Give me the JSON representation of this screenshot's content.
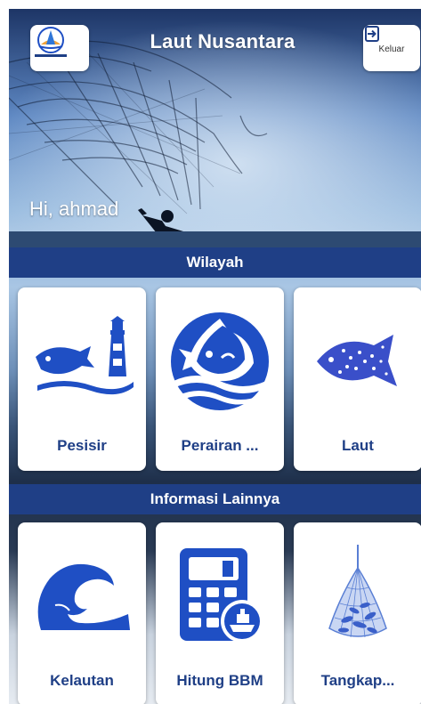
{
  "header": {
    "title": "Laut Nusantara",
    "logout_label": "Keluar",
    "logo_icon": "laut-nusantara-logo"
  },
  "greeting": "Hi, ahmad",
  "sections": {
    "wilayah": {
      "title": "Wilayah",
      "items": [
        {
          "label": "Pesisir",
          "icon": "lighthouse-fish-icon"
        },
        {
          "label": "Perairan ...",
          "icon": "fish-wave-icon"
        },
        {
          "label": "Laut",
          "icon": "fish-school-icon"
        }
      ]
    },
    "informasi": {
      "title": "Informasi Lainnya",
      "items": [
        {
          "label": "Kelautan",
          "icon": "wave-icon"
        },
        {
          "label": "Hitung BBM",
          "icon": "calculator-ship-icon"
        },
        {
          "label": "Tangkap...",
          "icon": "fishing-net-icon"
        }
      ]
    }
  },
  "colors": {
    "primary": "#1f3f86",
    "icon_blue": "#1f4fc4"
  }
}
